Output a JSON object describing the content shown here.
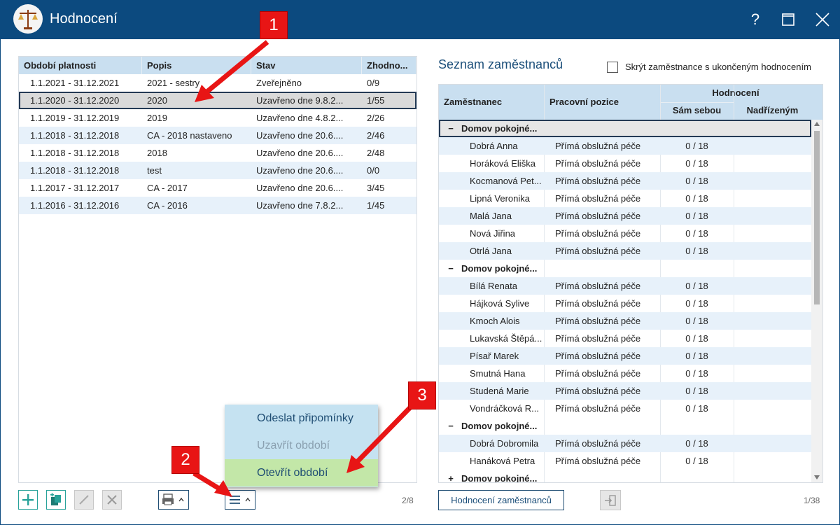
{
  "window": {
    "title": "Hodnocení",
    "help_label": "?"
  },
  "left_grid": {
    "headers": [
      "Období platnosti",
      "Popis",
      "Stav",
      "Zhodno..."
    ],
    "rows": [
      {
        "period": "1.1.2021 - 31.12.2021",
        "desc": "2021 - sestry",
        "state": "Zveřejněno",
        "score": "0/9"
      },
      {
        "period": "1.1.2020 - 31.12.2020",
        "desc": "2020",
        "state": "Uzavřeno dne 9.8.2...",
        "score": "1/55"
      },
      {
        "period": "1.1.2019 - 31.12.2019",
        "desc": "2019",
        "state": "Uzavřeno dne 4.8.2...",
        "score": "2/26"
      },
      {
        "period": "1.1.2018 - 31.12.2018",
        "desc": "CA - 2018 nastaveno",
        "state": "Uzavřeno dne 20.6....",
        "score": "2/46"
      },
      {
        "period": "1.1.2018 - 31.12.2018",
        "desc": "2018",
        "state": "Uzavřeno dne 20.6....",
        "score": "2/48"
      },
      {
        "period": "1.1.2018 - 31.12.2018",
        "desc": "test",
        "state": "Uzavřeno dne 20.6....",
        "score": "0/0"
      },
      {
        "period": "1.1.2017 - 31.12.2017",
        "desc": "CA - 2017",
        "state": "Uzavřeno dne 20.6....",
        "score": "3/45"
      },
      {
        "period": "1.1.2016 - 31.12.2016",
        "desc": "CA - 2016",
        "state": "Uzavřeno dne 7.8.2...",
        "score": "1/45"
      }
    ],
    "pager": "2/8"
  },
  "menu": {
    "items": [
      "Odeslat připomínky",
      "Uzavřít období",
      "Otevřít období"
    ]
  },
  "right_panel": {
    "title": "Seznam zaměstnanců",
    "hide_label": "Skrýt zaměstnance s ukončeným hodnocením",
    "headers": {
      "employee": "Zaměstnanec",
      "position": "Pracovní pozice",
      "evaluation": "Hodnocení",
      "self": "Sám sebou",
      "superior": "Nadřízeným"
    },
    "rows": [
      {
        "type": "group",
        "toggle": "−",
        "label": "Domov pokojné..."
      },
      {
        "type": "emp",
        "name": "Dobrá Anna",
        "position": "Přímá obslužná péče",
        "self": "0 / 18"
      },
      {
        "type": "emp",
        "name": "Horáková Eliška",
        "position": "Přímá obslužná péče",
        "self": "0 / 18"
      },
      {
        "type": "emp",
        "name": "Kocmanová Pet...",
        "position": "Přímá obslužná péče",
        "self": "0 / 18"
      },
      {
        "type": "emp",
        "name": "Lipná Veronika",
        "position": "Přímá obslužná péče",
        "self": "0 / 18"
      },
      {
        "type": "emp",
        "name": "Malá Jana",
        "position": "Přímá obslužná péče",
        "self": "0 / 18"
      },
      {
        "type": "emp",
        "name": "Nová Jiřina",
        "position": "Přímá obslužná péče",
        "self": "0 / 18"
      },
      {
        "type": "emp",
        "name": "Otrlá Jana",
        "position": "Přímá obslužná péče",
        "self": "0 / 18"
      },
      {
        "type": "group",
        "toggle": "−",
        "label": "Domov pokojné..."
      },
      {
        "type": "emp",
        "name": "Bílá Renata",
        "position": "Přímá obslužná péče",
        "self": "0 / 18"
      },
      {
        "type": "emp",
        "name": "Hájková Sylive",
        "position": "Přímá obslužná péče",
        "self": "0 / 18"
      },
      {
        "type": "emp",
        "name": "Kmoch Alois",
        "position": "Přímá obslužná péče",
        "self": "0 / 18"
      },
      {
        "type": "emp",
        "name": "Lukavská Štěpá...",
        "position": "Přímá obslužná péče",
        "self": "0 / 18"
      },
      {
        "type": "emp",
        "name": "Písař Marek",
        "position": "Přímá obslužná péče",
        "self": "0 / 18"
      },
      {
        "type": "emp",
        "name": "Smutná Hana",
        "position": "Přímá obslužná péče",
        "self": "0 / 18"
      },
      {
        "type": "emp",
        "name": "Studená Marie",
        "position": "Přímá obslužná péče",
        "self": "0 / 18"
      },
      {
        "type": "emp",
        "name": "Vondráčková R...",
        "position": "Přímá obslužná péče",
        "self": "0 / 18"
      },
      {
        "type": "group",
        "toggle": "−",
        "label": "Domov pokojné..."
      },
      {
        "type": "emp",
        "name": "Dobrá Dobromila",
        "position": "Přímá obslužná péče",
        "self": "0 / 18"
      },
      {
        "type": "emp",
        "name": "Hanáková Petra",
        "position": "Přímá obslužná péče",
        "self": "0 / 18"
      },
      {
        "type": "group",
        "toggle": "+",
        "label": "Domov pokojné..."
      }
    ],
    "eval_button": "Hodnocení zaměstnanců",
    "pager": "1/38"
  },
  "annotations": [
    "1",
    "2",
    "3"
  ],
  "colors": {
    "titlebar": "#0c4a7f",
    "header": "#c9dff0",
    "alt_row": "#e7f1fa",
    "menu_bg": "#c5e2f1",
    "menu_highlight": "#c3e7a8",
    "annotation": "#e81515"
  }
}
